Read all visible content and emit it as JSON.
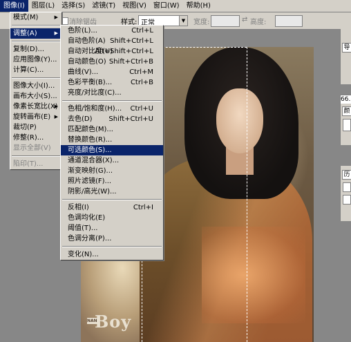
{
  "menubar": {
    "items": [
      {
        "label": "图像(I)",
        "active": true
      },
      {
        "label": "图层(L)",
        "active": false
      },
      {
        "label": "选择(S)",
        "active": false
      },
      {
        "label": "滤镜(T)",
        "active": false
      },
      {
        "label": "视图(V)",
        "active": false
      },
      {
        "label": "窗口(W)",
        "active": false
      },
      {
        "label": "帮助(H)",
        "active": false
      }
    ]
  },
  "options_bar": {
    "antialias_label": "消除锯齿",
    "style_label": "样式:",
    "style_value": "正常",
    "width_label": "宽度:",
    "height_label": "高度:",
    "swap_glyph": "⇄"
  },
  "image_menu": {
    "items": [
      {
        "label": "模式(M)",
        "submenu": true,
        "disabled": false,
        "highlighted": false
      },
      {
        "separator": true
      },
      {
        "label": "调整(A)",
        "submenu": true,
        "disabled": false,
        "highlighted": true
      },
      {
        "separator": true
      },
      {
        "label": "复制(D)...",
        "submenu": false,
        "disabled": false,
        "highlighted": false
      },
      {
        "label": "应用图像(Y)...",
        "submenu": false,
        "disabled": false,
        "highlighted": false
      },
      {
        "label": "计算(C)...",
        "submenu": false,
        "disabled": false,
        "highlighted": false
      },
      {
        "separator": true
      },
      {
        "label": "图像大小(I)...",
        "submenu": false,
        "disabled": false,
        "highlighted": false
      },
      {
        "label": "画布大小(S)...",
        "submenu": false,
        "disabled": false,
        "highlighted": false
      },
      {
        "label": "像素长宽比(X)",
        "submenu": true,
        "disabled": false,
        "highlighted": false
      },
      {
        "label": "旋转画布(E)",
        "submenu": true,
        "disabled": false,
        "highlighted": false
      },
      {
        "label": "裁切(P)",
        "submenu": false,
        "disabled": false,
        "highlighted": false
      },
      {
        "label": "修整(R)...",
        "submenu": false,
        "disabled": false,
        "highlighted": false
      },
      {
        "label": "显示全部(V)",
        "submenu": false,
        "disabled": true,
        "highlighted": false
      },
      {
        "separator": true
      },
      {
        "label": "陷印(T)...",
        "submenu": false,
        "disabled": true,
        "highlighted": false
      }
    ]
  },
  "adjust_submenu": {
    "items": [
      {
        "label": "色阶(L)...",
        "shortcut": "Ctrl+L"
      },
      {
        "label": "自动色阶(A)",
        "shortcut": "Shift+Ctrl+L"
      },
      {
        "label": "自动对比度(U)",
        "shortcut": "Alt+Shift+Ctrl+L"
      },
      {
        "label": "自动颜色(O)",
        "shortcut": "Shift+Ctrl+B"
      },
      {
        "label": "曲线(V)...",
        "shortcut": "Ctrl+M"
      },
      {
        "label": "色彩平衡(B)...",
        "shortcut": "Ctrl+B"
      },
      {
        "label": "亮度/对比度(C)...",
        "shortcut": ""
      },
      {
        "separator": true
      },
      {
        "label": "色相/饱和度(H)...",
        "shortcut": "Ctrl+U"
      },
      {
        "label": "去色(D)",
        "shortcut": "Shift+Ctrl+U"
      },
      {
        "label": "匹配颜色(M)...",
        "shortcut": ""
      },
      {
        "label": "替换颜色(R)...",
        "shortcut": ""
      },
      {
        "label": "可选颜色(S)...",
        "shortcut": "",
        "highlighted": true
      },
      {
        "label": "通道混合器(X)...",
        "shortcut": ""
      },
      {
        "label": "渐变映射(G)...",
        "shortcut": ""
      },
      {
        "label": "照片滤镜(F)...",
        "shortcut": ""
      },
      {
        "label": "阴影/高光(W)...",
        "shortcut": ""
      },
      {
        "separator": true
      },
      {
        "label": "反相(I)",
        "shortcut": "Ctrl+I"
      },
      {
        "label": "色调均化(E)",
        "shortcut": ""
      },
      {
        "label": "阈值(T)...",
        "shortcut": ""
      },
      {
        "label": "色调分离(P)...",
        "shortcut": ""
      },
      {
        "separator": true
      },
      {
        "label": "变化(N)...",
        "shortcut": ""
      }
    ]
  },
  "canvas": {
    "logo_text": "Boy",
    "logo_tag": "NANA"
  },
  "right_panel": {
    "tab1": "导",
    "tab2": "颜",
    "tab3": "历",
    "zoom_value": "66."
  }
}
